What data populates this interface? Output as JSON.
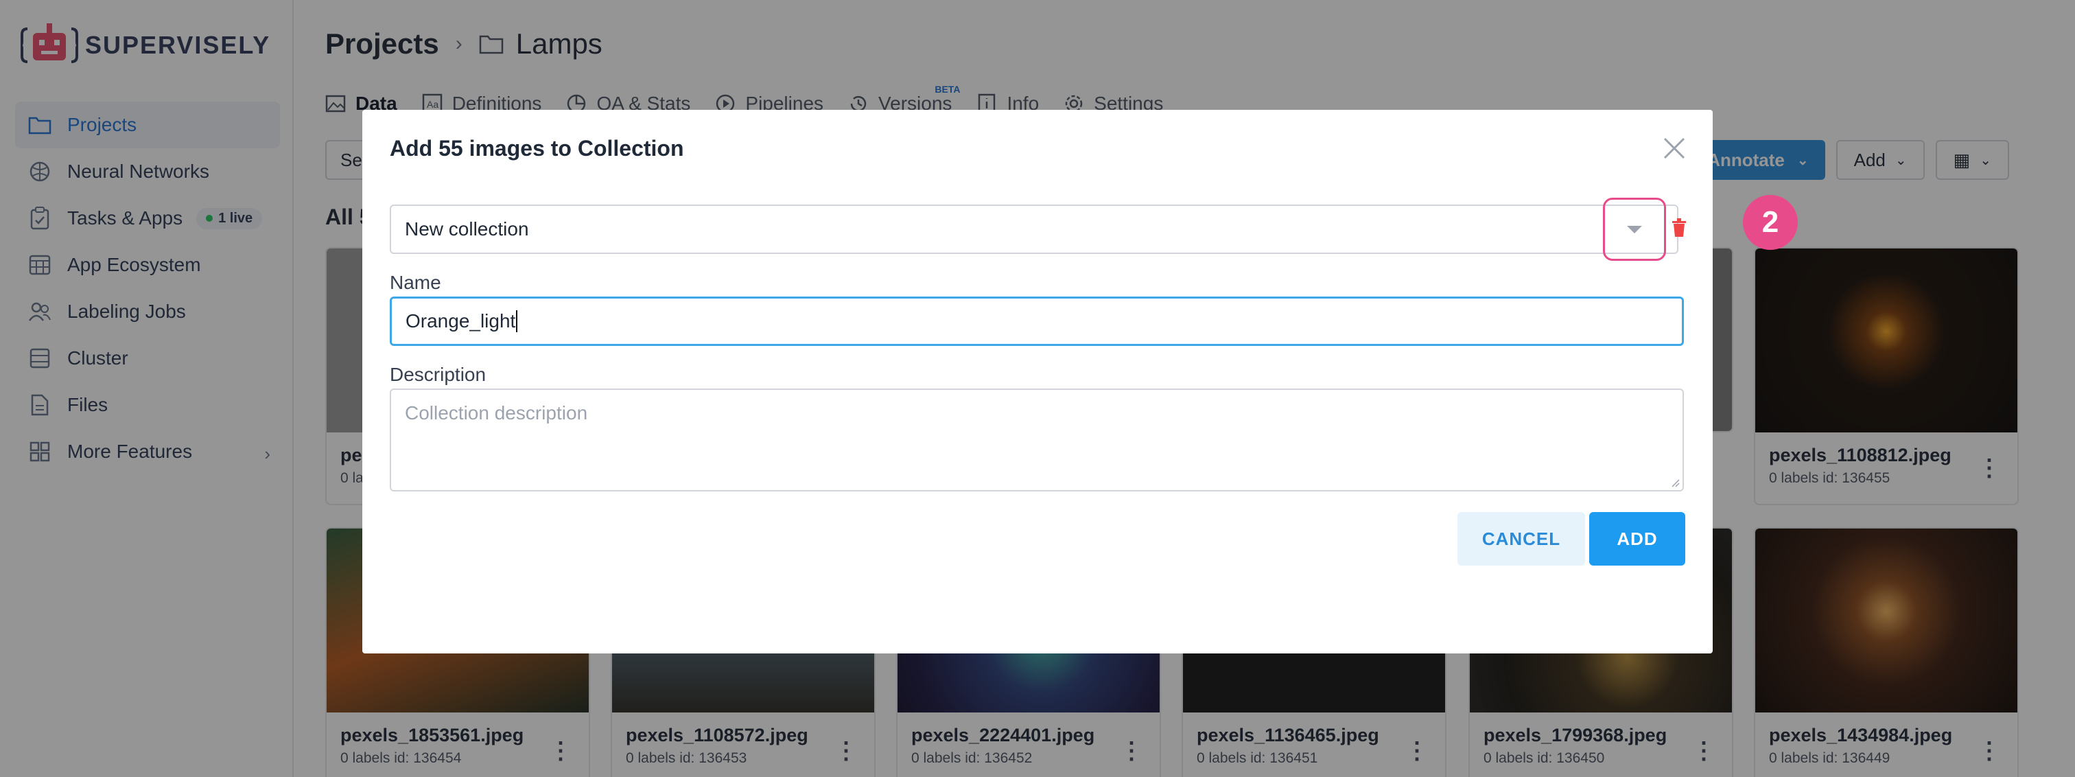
{
  "colors": {
    "accent": "#2a8bd8",
    "highlight": "#e84b8a",
    "live": "#22c55e"
  },
  "sidebar": {
    "logo_text": "SUPERVISELY",
    "items": [
      {
        "label": "Projects",
        "icon": "folder-icon",
        "active": true
      },
      {
        "label": "Neural Networks",
        "icon": "brain-icon"
      },
      {
        "label": "Tasks & Apps",
        "icon": "clipboard-icon",
        "badge": "1 live"
      },
      {
        "label": "App Ecosystem",
        "icon": "grid-window-icon"
      },
      {
        "label": "Labeling Jobs",
        "icon": "users-icon"
      },
      {
        "label": "Cluster",
        "icon": "server-icon"
      },
      {
        "label": "Files",
        "icon": "file-icon"
      },
      {
        "label": "More Features",
        "icon": "apps-icon"
      }
    ]
  },
  "header": {
    "root": "Projects",
    "current": "Lamps"
  },
  "tabs": [
    {
      "label": "Data",
      "icon": "image-icon"
    },
    {
      "label": "Definitions",
      "icon": "text-box-icon"
    },
    {
      "label": "QA & Stats",
      "icon": "pie-chart-icon"
    },
    {
      "label": "Pipelines",
      "icon": "play-circle-icon"
    },
    {
      "label": "Versions",
      "icon": "history-icon",
      "beta": "BETA"
    },
    {
      "label": "Info",
      "icon": "info-icon"
    },
    {
      "label": "Settings",
      "icon": "gear-icon"
    }
  ],
  "toolbar": {
    "left_label": "Se",
    "annotate": "Annotate",
    "add": "Add"
  },
  "main": {
    "all_label": "All 5"
  },
  "cards": [
    {
      "title": "pe",
      "meta": "0 la"
    },
    {
      "title": "pexels_1108812.jpeg",
      "meta": "0 labels  id: 136455"
    },
    {
      "title": "pexels_1853561.jpeg",
      "meta": "0 labels  id: 136454"
    },
    {
      "title": "pexels_1108572.jpeg",
      "meta": "0 labels  id: 136453"
    },
    {
      "title": "pexels_2224401.jpeg",
      "meta": "0 labels  id: 136452"
    },
    {
      "title": "pexels_1136465.jpeg",
      "meta": "0 labels  id: 136451"
    },
    {
      "title": "pexels_1799368.jpeg",
      "meta": "0 labels  id: 136450"
    },
    {
      "title": "pexels_1434984.jpeg",
      "meta": "0 labels  id: 136449"
    }
  ],
  "modal": {
    "title": "Add 55 images to Collection",
    "collection_value": "New collection",
    "name_label": "Name",
    "name_value": "Orange_light",
    "description_label": "Description",
    "description_placeholder": "Collection description",
    "cancel": "CANCEL",
    "add": "ADD"
  },
  "step_badge": "2"
}
